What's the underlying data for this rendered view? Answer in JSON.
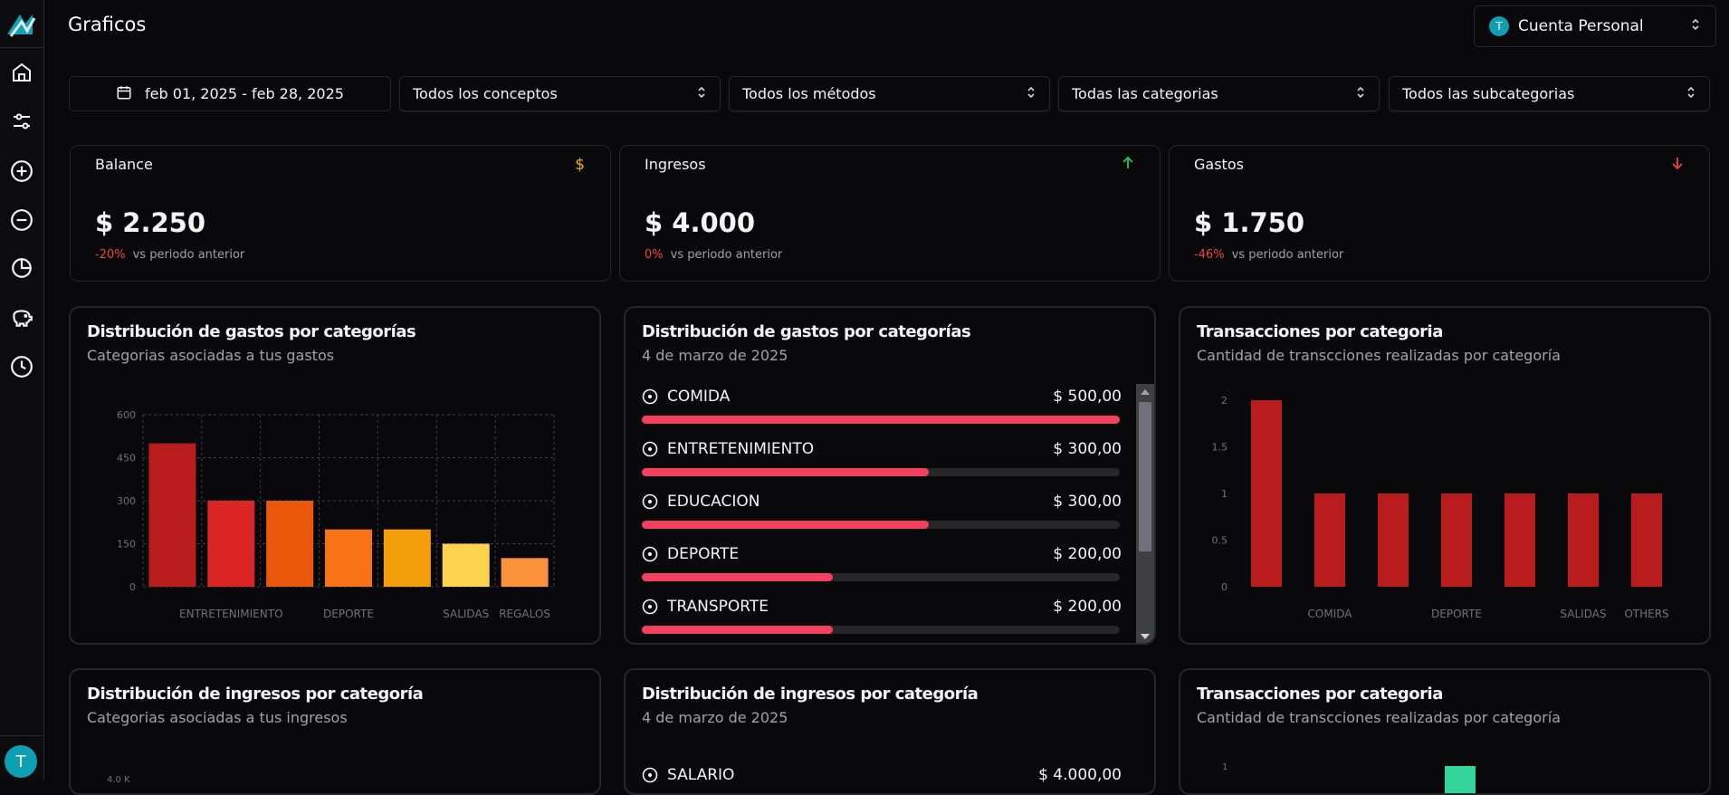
{
  "header": {
    "title": "Graficos"
  },
  "account": {
    "avatar_letter": "T",
    "name": "Cuenta Personal"
  },
  "user": {
    "avatar_letter": "T"
  },
  "filters": {
    "date_range": "feb 01, 2025 - feb 28, 2025",
    "concepts": "Todos los conceptos",
    "methods": "Todos los métodos",
    "categories": "Todas las categorias",
    "subcategories": "Todos las subcategorias"
  },
  "stats": [
    {
      "label": "Balance",
      "icon": "dollar-icon",
      "value": "$ 2.250",
      "change": "-20%",
      "compare": "vs periodo anterior",
      "color": "#eab308"
    },
    {
      "label": "Ingresos",
      "icon": "arrow-up-icon",
      "value": "$ 4.000",
      "change": "0%",
      "compare": "vs periodo anterior",
      "color": "#22c55e"
    },
    {
      "label": "Gastos",
      "icon": "arrow-down-icon",
      "value": "$ 1.750",
      "change": "-46%",
      "compare": "vs periodo anterior",
      "color": "#ef4444"
    }
  ],
  "cards": {
    "expense_bar": {
      "title": "Distribución de gastos por categorías",
      "desc": "Categorias asociadas a tus gastos"
    },
    "expense_list": {
      "title": "Distribución de gastos por categorías",
      "desc": "4 de marzo de 2025"
    },
    "expense_tx": {
      "title": "Transacciones por categoria",
      "desc": "Cantidad de transcciones realizadas por categoría"
    },
    "income_bar": {
      "title": "Distribución de ingresos por categoría",
      "desc": "Categorias asociadas a tus ingresos",
      "partial_tick": "4.0 K"
    },
    "income_list": {
      "title": "Distribución de ingresos por categoría",
      "desc": "4 de marzo de 2025"
    },
    "income_tx": {
      "title": "Transacciones por categoria",
      "desc": "Cantidad de transcciones realizadas por categoría",
      "partial_tick": "1"
    }
  },
  "expense_list": [
    {
      "name": "COMIDA",
      "amount": "$ 500,00",
      "ratio": 1.0
    },
    {
      "name": "ENTRETENIMIENTO",
      "amount": "$ 300,00",
      "ratio": 0.6
    },
    {
      "name": "EDUCACION",
      "amount": "$ 300,00",
      "ratio": 0.6
    },
    {
      "name": "DEPORTE",
      "amount": "$ 200,00",
      "ratio": 0.4
    },
    {
      "name": "TRANSPORTE",
      "amount": "$ 200,00",
      "ratio": 0.4
    }
  ],
  "income_list": [
    {
      "name": "SALARIO",
      "amount": "$ 4.000,00"
    }
  ],
  "chart_data": [
    {
      "type": "bar",
      "categories": [
        "",
        "ENTRETENIMIENTO",
        "",
        "DEPORTE",
        "",
        "SALIDAS",
        "REGALOS"
      ],
      "values": [
        500,
        300,
        300,
        200,
        200,
        150,
        100
      ],
      "colors": [
        "#b91c1c",
        "#dc2626",
        "#ea580c",
        "#f97316",
        "#f59e0b",
        "#fcd34d",
        "#fb923c"
      ],
      "yticks": [
        "0",
        "150",
        "300",
        "450",
        "600"
      ],
      "ylim": [
        0,
        600
      ],
      "grid": true
    },
    {
      "type": "bar",
      "categories": [
        "",
        "COMIDA",
        "",
        "DEPORTE",
        "",
        "SALIDAS",
        "OTHERS"
      ],
      "values": [
        2,
        1,
        1,
        1,
        1,
        1,
        1
      ],
      "colors": [
        "#b91c1c"
      ],
      "yticks": [
        "0",
        "0.5",
        "1",
        "1.5",
        "2"
      ],
      "ylim": [
        0,
        2
      ],
      "grid": false
    }
  ]
}
